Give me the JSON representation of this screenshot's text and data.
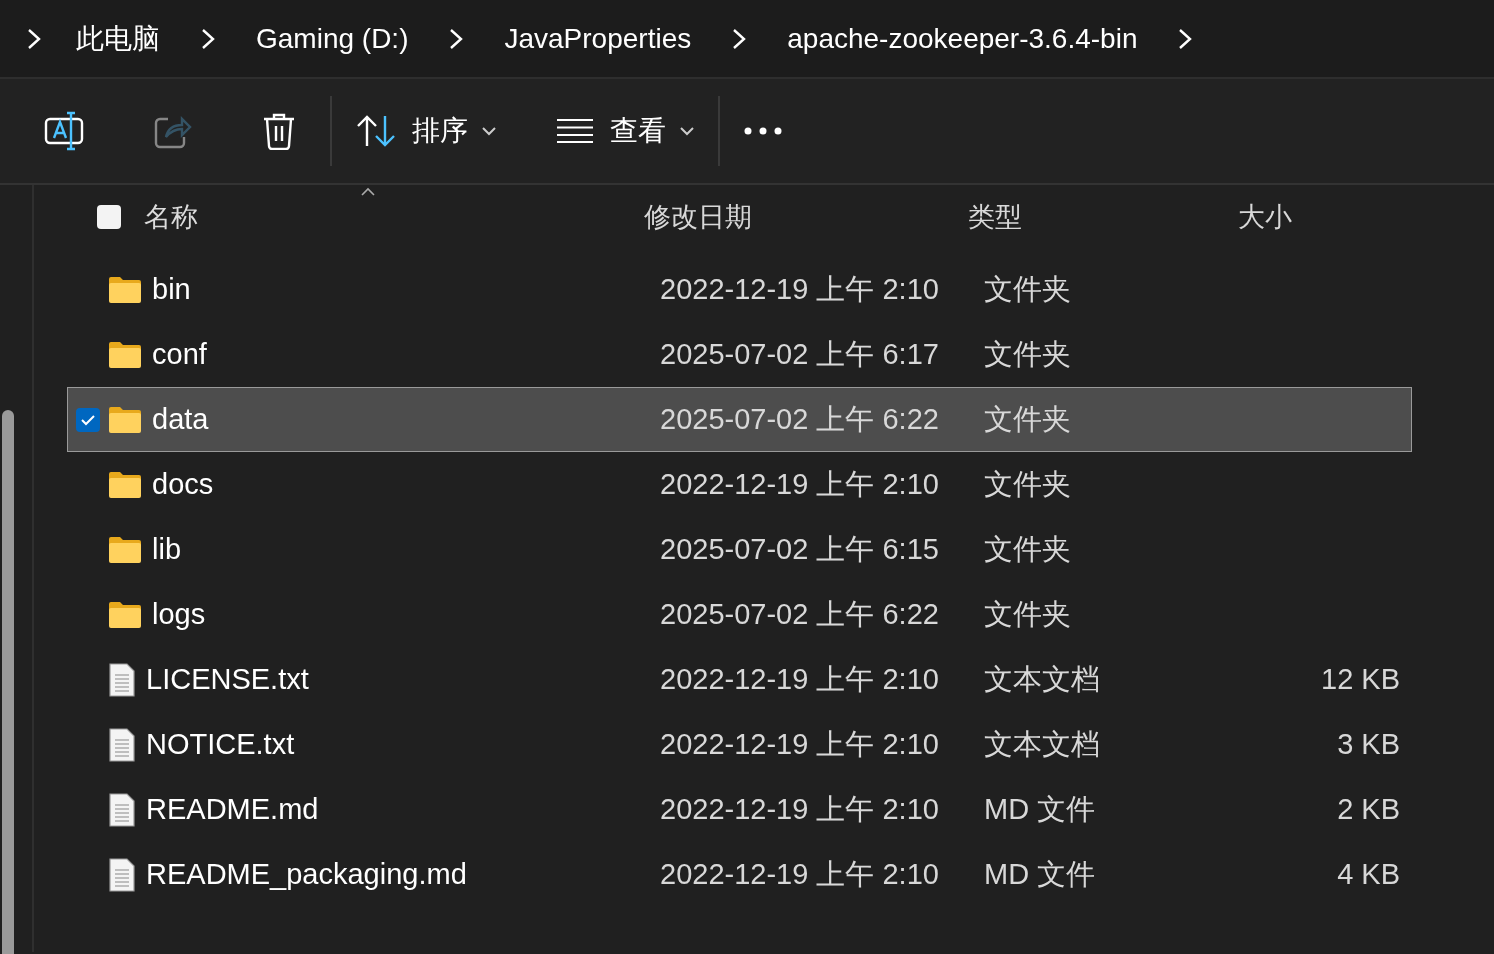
{
  "breadcrumb": [
    "此电脑",
    "Gaming (D:)",
    "JavaProperties",
    "apache-zookeeper-3.6.4-bin"
  ],
  "toolbar": [
    {
      "kind": "rename",
      "disabled": false
    },
    {
      "kind": "share",
      "disabled": true
    },
    {
      "kind": "delete",
      "disabled": false
    },
    {
      "kind": "sort",
      "label": "排序",
      "disabled": false
    },
    {
      "kind": "view",
      "label": "查看",
      "disabled": false
    },
    {
      "kind": "more",
      "disabled": false
    }
  ],
  "header": {
    "checked": false,
    "columns": [
      "名称",
      "修改日期",
      "类型",
      "大小"
    ]
  },
  "rows": [
    {
      "kind": "folder",
      "name": "bin",
      "date": "2022-12-19 上午 2:10",
      "type": "文件夹",
      "selected": false
    },
    {
      "kind": "folder",
      "name": "conf",
      "date": "2025-07-02 上午 6:17",
      "type": "文件夹",
      "selected": false
    },
    {
      "kind": "folder",
      "name": "data",
      "date": "2025-07-02 上午 6:22",
      "type": "文件夹",
      "selected": true
    },
    {
      "kind": "folder",
      "name": "docs",
      "date": "2022-12-19 上午 2:10",
      "type": "文件夹",
      "selected": false
    },
    {
      "kind": "folder",
      "name": "lib",
      "date": "2025-07-02 上午 6:15",
      "type": "文件夹",
      "selected": false
    },
    {
      "kind": "folder",
      "name": "logs",
      "date": "2025-07-02 上午 6:22",
      "type": "文件夹",
      "selected": false
    },
    {
      "kind": "file",
      "name": "LICENSE.txt",
      "date": "2022-12-19 上午 2:10",
      "type": "文本文档",
      "size": "12 KB",
      "selected": false
    },
    {
      "kind": "file",
      "name": "NOTICE.txt",
      "date": "2022-12-19 上午 2:10",
      "type": "文本文档",
      "size": "3 KB",
      "selected": false
    },
    {
      "kind": "file",
      "name": "README.md",
      "date": "2022-12-19 上午 2:10",
      "type": "MD 文件",
      "size": "2 KB",
      "selected": false
    },
    {
      "kind": "file",
      "name": "README_packaging.md",
      "date": "2022-12-19 上午 2:10",
      "type": "MD 文件",
      "size": "4 KB",
      "selected": false
    }
  ]
}
